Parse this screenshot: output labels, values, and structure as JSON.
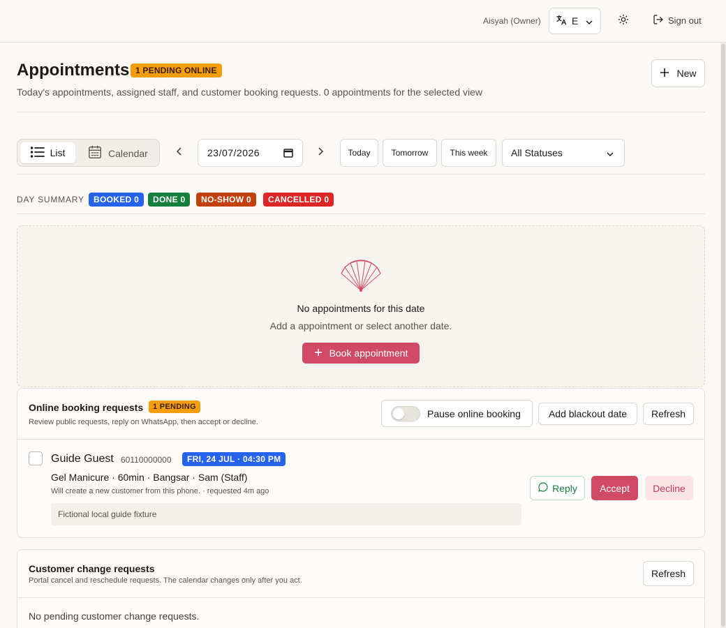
{
  "topbar": {
    "user": "Aisyah (Owner)",
    "language": "E",
    "signout": "Sign out"
  },
  "header": {
    "title": "Appointments",
    "pending_badge": "1 PENDING ONLINE",
    "subtitle": "Today's appointments, assigned staff, and customer booking requests. 0 appointments for the selected view",
    "new_label": "New"
  },
  "toolbar": {
    "view_list": "List",
    "view_calendar": "Calendar",
    "date": "23/07/2026",
    "today": "Today",
    "tomorrow": "Tomorrow",
    "this_week": "This week",
    "status_filter": "All Statuses"
  },
  "summary": {
    "label": "DAY SUMMARY",
    "booked": "BOOKED 0",
    "done": "DONE 0",
    "no_show": "NO-SHOW 0",
    "cancelled": "CANCELLED 0",
    "colors": {
      "booked": "#2563eb",
      "done": "#15803d",
      "no_show": "#c2410c",
      "cancelled": "#dc2626"
    }
  },
  "empty": {
    "title": "No appointments for this date",
    "subtitle": "Add a appointment or select another date.",
    "book_label": "Book appointment"
  },
  "online_requests": {
    "title": "Online booking requests",
    "badge": "1 PENDING",
    "subtitle": "Review public requests, reply on WhatsApp, then accept or decline.",
    "pause_label": "Pause online booking",
    "pause_on": false,
    "blackout_label": "Add blackout date",
    "refresh_label": "Refresh",
    "items": [
      {
        "name": "Guide Guest",
        "phone": "60110000000",
        "time": "FRI, 24 JUL · 04:30 PM",
        "service": "Gel Manicure · 60min · Bangsar · Sam (Staff)",
        "note": "Will create a new customer from this phone. · requested 4m ago",
        "fixture": "Fictional local guide fixture",
        "reply": "Reply",
        "accept": "Accept",
        "decline": "Decline"
      }
    ]
  },
  "change_requests": {
    "title": "Customer change requests",
    "subtitle": "Portal cancel and reschedule requests. The calendar changes only after you act.",
    "refresh_label": "Refresh",
    "empty": "No pending customer change requests."
  },
  "colors": {
    "accent": "#d04a66",
    "warning": "#f59e0b",
    "background": "#fbf9f6"
  }
}
